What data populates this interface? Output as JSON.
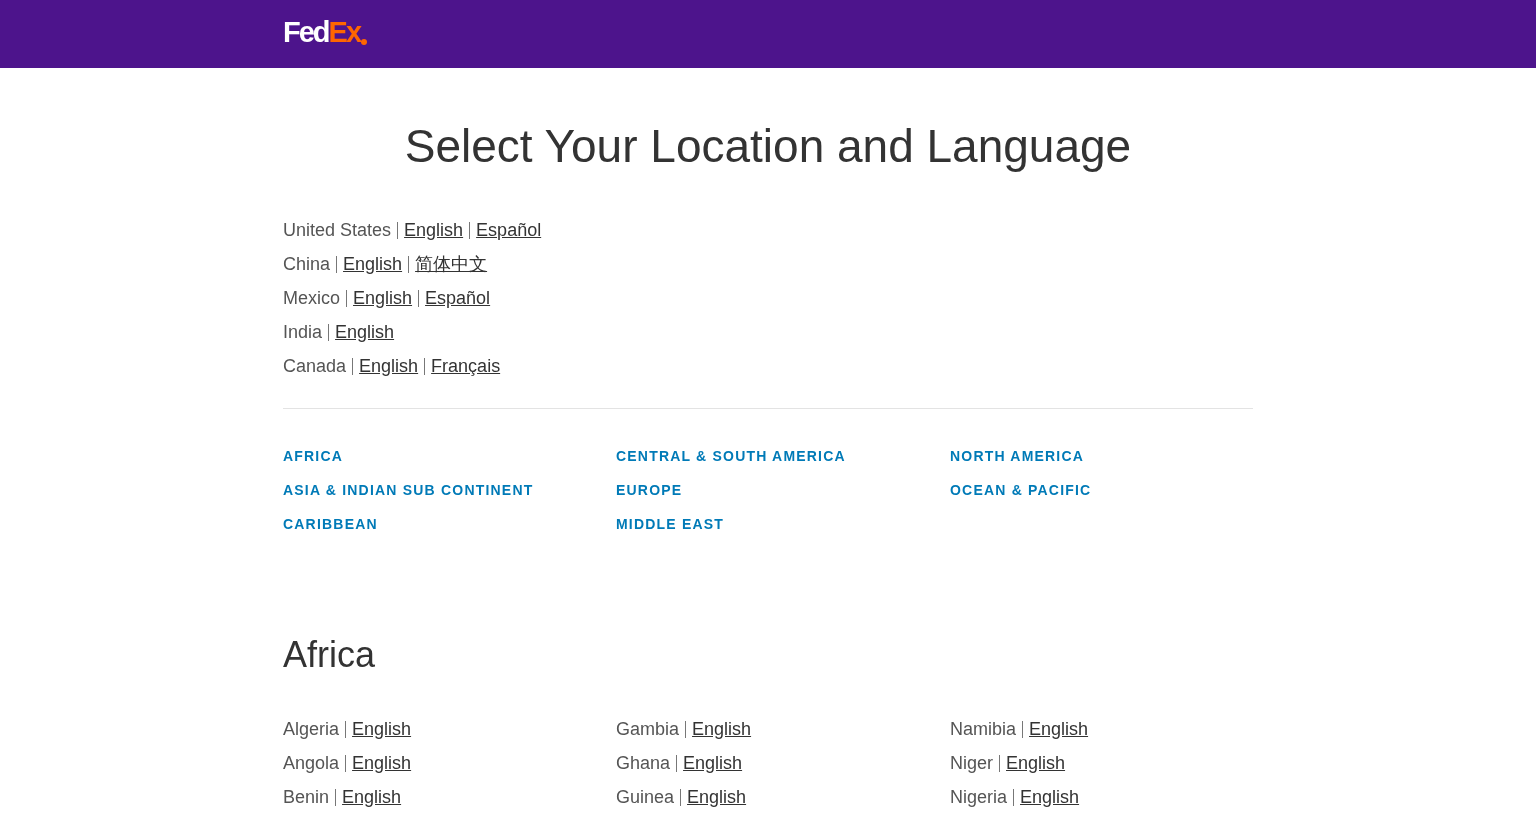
{
  "header": {
    "logo": {
      "first": "Fed",
      "second": "Ex"
    }
  },
  "title": "Select Your Location and Language",
  "featured": [
    {
      "country": "United States",
      "languages": [
        "English",
        "Español"
      ]
    },
    {
      "country": "China",
      "languages": [
        "English",
        "简体中文"
      ]
    },
    {
      "country": "Mexico",
      "languages": [
        "English",
        "Español"
      ]
    },
    {
      "country": "India",
      "languages": [
        "English"
      ]
    },
    {
      "country": "Canada",
      "languages": [
        "English",
        "Français"
      ]
    }
  ],
  "regions": [
    [
      "AFRICA",
      "ASIA & INDIAN SUB CONTINENT",
      "CARIBBEAN"
    ],
    [
      "CENTRAL & SOUTH AMERICA",
      "EUROPE",
      "MIDDLE EAST"
    ],
    [
      "NORTH AMERICA",
      "OCEAN & PACIFIC"
    ]
  ],
  "sections": [
    {
      "heading": "Africa",
      "columns": [
        [
          {
            "country": "Algeria",
            "languages": [
              "English"
            ]
          },
          {
            "country": "Angola",
            "languages": [
              "English"
            ]
          },
          {
            "country": "Benin",
            "languages": [
              "English"
            ]
          }
        ],
        [
          {
            "country": "Gambia",
            "languages": [
              "English"
            ]
          },
          {
            "country": "Ghana",
            "languages": [
              "English"
            ]
          },
          {
            "country": "Guinea",
            "languages": [
              "English"
            ]
          }
        ],
        [
          {
            "country": "Namibia",
            "languages": [
              "English"
            ]
          },
          {
            "country": "Niger",
            "languages": [
              "English"
            ]
          },
          {
            "country": "Nigeria",
            "languages": [
              "English"
            ]
          }
        ]
      ]
    }
  ]
}
